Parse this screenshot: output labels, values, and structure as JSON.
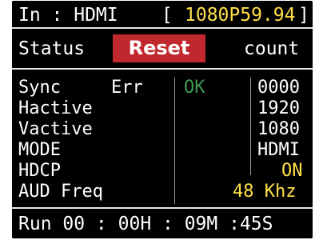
{
  "header": {
    "input_label": "In : HDMI",
    "bracket_open": "[",
    "resolution": "1080P59.94",
    "bracket_close": "]"
  },
  "toolbar": {
    "status_label": "Status",
    "reset_label": "Reset",
    "count_label": "count"
  },
  "table": {
    "rows": [
      {
        "label": "Sync",
        "label2": "Err",
        "status": "OK",
        "value": "0000"
      },
      {
        "label": "Hactive",
        "status": "",
        "value": "1920"
      },
      {
        "label": "Vactive",
        "status": "",
        "value": "1080"
      },
      {
        "label": "MODE",
        "status": "",
        "value": "HDMI"
      },
      {
        "label": "HDCP",
        "status": "",
        "value": "ON"
      },
      {
        "label": "AUD Freq",
        "status": "",
        "value": "48 Khz"
      }
    ]
  },
  "footer": {
    "runtime": "Run 00 : 00H : 09M :45S"
  },
  "colors": {
    "background": "#000000",
    "highlight": "#ffe14a",
    "ok": "#3f9a50",
    "reset_button": "#c0282d",
    "divider": "#e6e6e6"
  }
}
